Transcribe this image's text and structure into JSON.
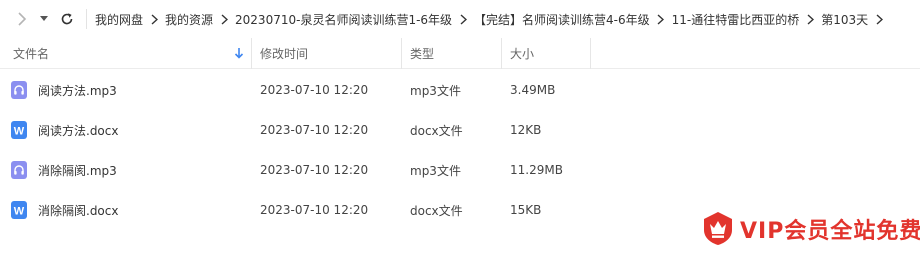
{
  "breadcrumb": {
    "items": [
      {
        "label": "我的网盘"
      },
      {
        "label": "我的资源"
      },
      {
        "label": "20230710-泉灵名师阅读训练营1-6年级"
      },
      {
        "label": "【完结】名师阅读训练营4-6年级"
      },
      {
        "label": "11-通往特雷比西亚的桥"
      },
      {
        "label": "第103天"
      }
    ]
  },
  "table": {
    "headers": {
      "name": "文件名",
      "date": "修改时间",
      "type": "类型",
      "size": "大小"
    },
    "sort_icon": "arrow-down-icon",
    "rows": [
      {
        "icon": "audio-file-icon",
        "name": "阅读方法.mp3",
        "date": "2023-07-10 12:20",
        "type": "mp3文件",
        "size": "3.49MB"
      },
      {
        "icon": "word-file-icon",
        "name": "阅读方法.docx",
        "date": "2023-07-10 12:20",
        "type": "docx文件",
        "size": "12KB"
      },
      {
        "icon": "audio-file-icon",
        "name": "消除隔阂.mp3",
        "date": "2023-07-10 12:20",
        "type": "mp3文件",
        "size": "11.29MB"
      },
      {
        "icon": "word-file-icon",
        "name": "消除隔阂.docx",
        "date": "2023-07-10 12:20",
        "type": "docx文件",
        "size": "15KB"
      }
    ]
  },
  "vip": {
    "label": "VIP会员全站免费",
    "icon": "crown-icon"
  },
  "colors": {
    "audio_icon": "#8b8ff0",
    "word_icon": "#3f86f0",
    "accent": "#3f86f0",
    "vip_red": "#e2342d"
  }
}
